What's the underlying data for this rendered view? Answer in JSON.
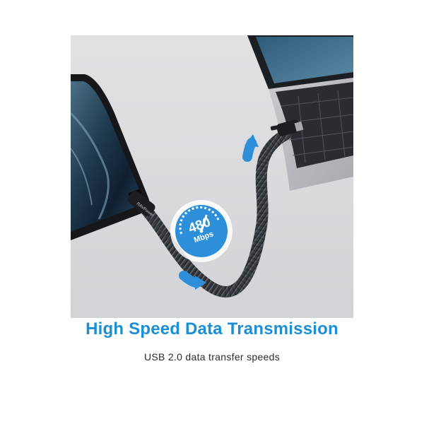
{
  "badge": {
    "value": "480",
    "unit": "Mbps"
  },
  "cable_brand_text": "RAVPower",
  "headline": "High Speed Data Transmission",
  "subtitle": "USB 2.0 data transfer speeds",
  "colors": {
    "accent_blue": "#1a8fd6",
    "badge_blue": "#2d8fd9",
    "background_gray": "#dcdcdf",
    "text_dark": "#2b2b2b"
  },
  "icons": [
    "speedometer-icon",
    "direction-arrow-icon"
  ]
}
